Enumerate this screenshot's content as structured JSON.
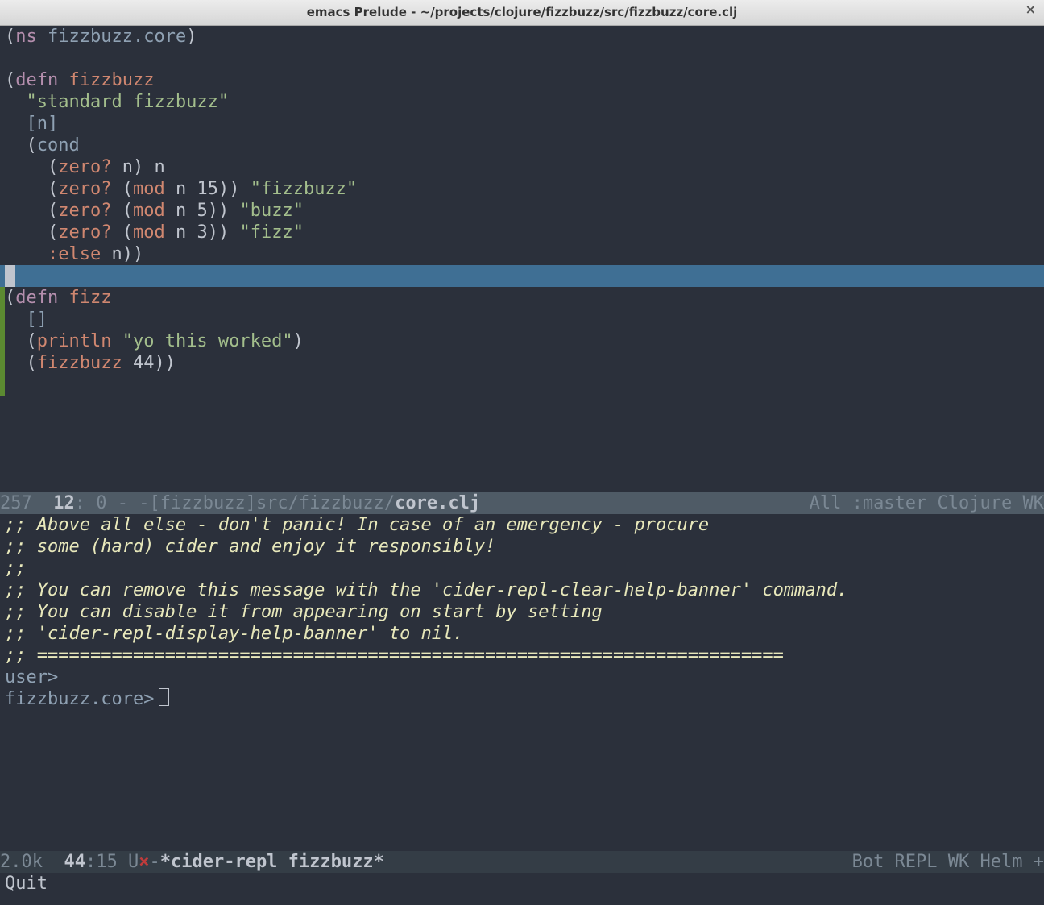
{
  "window": {
    "title": "emacs Prelude - ~/projects/clojure/fizzbuzz/src/fizzbuzz/core.clj",
    "close_glyph": "×"
  },
  "code": {
    "l1_ns": "ns",
    "l1_name": "fizzbuzz.core",
    "l3_defn": "defn",
    "l3_name": "fizzbuzz",
    "l4_docstr": "\"standard fizzbuzz\"",
    "l5_args": "[n]",
    "l6_cond": "cond",
    "l7_zero": "zero?",
    "l7_n": "n",
    "l7_ret": "n",
    "l8_zero": "zero?",
    "l8_mod": "mod",
    "l8_n": "n",
    "l8_15": "15",
    "l8_str": "\"fizzbuzz\"",
    "l9_zero": "zero?",
    "l9_mod": "mod",
    "l9_n": "n",
    "l9_5": "5",
    "l9_str": "\"buzz\"",
    "l10_zero": "zero?",
    "l10_mod": "mod",
    "l10_n": "n",
    "l10_3": "3",
    "l10_str": "\"fizz\"",
    "l11_else": ":else",
    "l11_n": "n",
    "l13_defn": "defn",
    "l13_name": "fizz",
    "l14_args": "[]",
    "l15_println": "println",
    "l15_str": "\"yo this worked\"",
    "l16_call": "fizzbuzz",
    "l16_44": "44"
  },
  "modeline_top": {
    "size": "257",
    "line": "12",
    "col": "0",
    "flags": " - -",
    "project": "[fizzbuzz]",
    "path": "src/fizzbuzz/",
    "file": "core.clj",
    "right": "All :master Clojure WK"
  },
  "repl": {
    "c1": ";; Above all else - don't panic! In case of an emergency - procure",
    "c2": ";; some (hard) cider and enjoy it responsibly!",
    "c3": ";;",
    "c4": ";; You can remove this message with the 'cider-repl-clear-help-banner' command.",
    "c5": ";; You can disable it from appearing on start by setting",
    "c6": ";; 'cider-repl-display-help-banner' to nil.",
    "c7": ";; ======================================================================",
    "p1": "user>",
    "p2": "fizzbuzz.core>"
  },
  "modeline_bot": {
    "size": "2.0k",
    "line": "44",
    "col": "15",
    "u": " U",
    "x": "×",
    "dash": "-",
    "file": "*cider-repl fizzbuzz*",
    "right": "Bot REPL WK Helm +"
  },
  "minibuffer": "Quit"
}
